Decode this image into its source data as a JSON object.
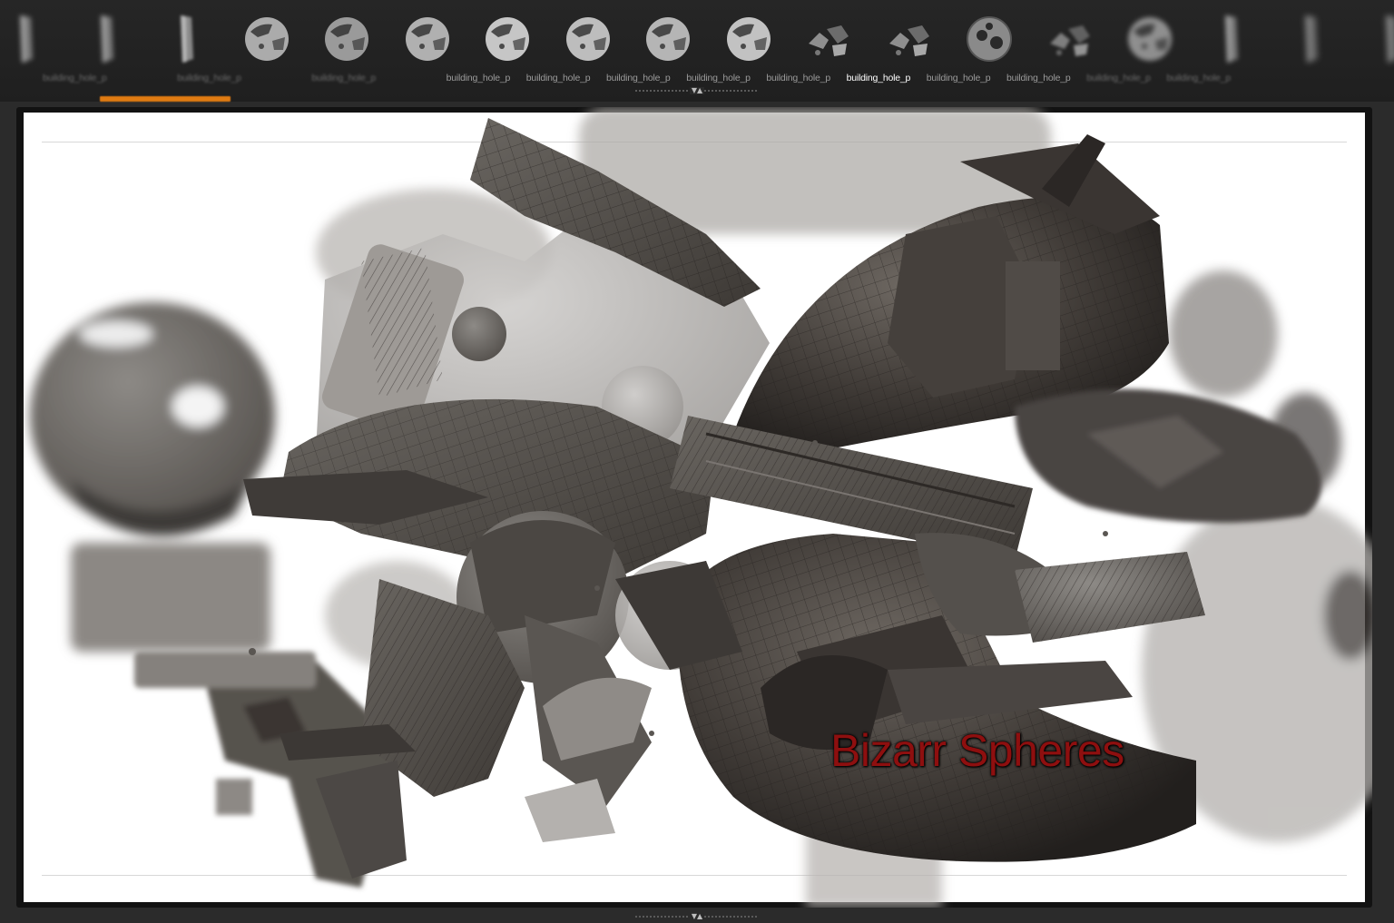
{
  "shelf": {
    "labels": [
      {
        "text": "building_hole_p",
        "state": "faded"
      },
      {
        "text": "building_hole_p",
        "state": "faded"
      },
      {
        "text": "building_hole_p",
        "state": "faded"
      },
      {
        "text": "building_hole_p",
        "state": "normal"
      },
      {
        "text": "building_hole_p",
        "state": "normal"
      },
      {
        "text": "building_hole_p",
        "state": "normal"
      },
      {
        "text": "building_hole_p",
        "state": "normal"
      },
      {
        "text": "building_hole_p",
        "state": "normal"
      },
      {
        "text": "building_hole_p",
        "state": "active"
      },
      {
        "text": "building_hole_p",
        "state": "normal"
      },
      {
        "text": "building_hole_p",
        "state": "normal"
      },
      {
        "text": "building_hole_p",
        "state": "faded"
      },
      {
        "text": "building_hole_p",
        "state": "faded"
      }
    ],
    "thumbnail_icons": [
      "pillar-thumbnail-icon",
      "pillar-thumbnail-icon",
      "pillar-thumbnail-icon",
      "sphere-thumbnail-icon",
      "sphere-thumbnail-icon",
      "sphere-thumbnail-icon",
      "sphere-thumbnail-icon",
      "sphere-thumbnail-icon",
      "sphere-thumbnail-icon",
      "sphere-thumbnail-icon",
      "fragments-thumbnail-icon",
      "fragments-thumbnail-icon",
      "hollow-sphere-thumbnail-icon",
      "fragments-thumbnail-icon",
      "sphere-thumbnail-icon",
      "pillar-thumbnail-icon",
      "pillar-thumbnail-icon",
      "pillar-thumbnail-icon"
    ],
    "scroll_accent_color": "#e07b12",
    "splitter_glyph": "▼▲"
  },
  "viewport": {
    "caption": "Bizarr Spheres",
    "caption_color": "#8e0f0f",
    "background_color": "#ffffff",
    "splitter_glyph": "▼▲"
  }
}
